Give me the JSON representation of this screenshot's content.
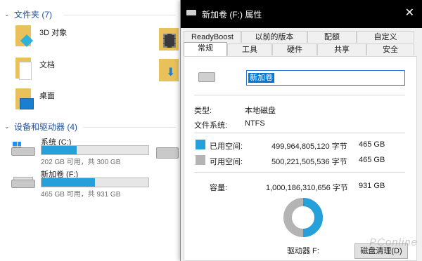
{
  "explorer": {
    "folders_header": "文件夹 (7)",
    "folders": [
      {
        "label": "3D 对象"
      },
      {
        "label": "文档"
      },
      {
        "label": "桌面"
      }
    ],
    "devices_header": "设备和驱动器 (4)",
    "drives": [
      {
        "name": "系统 (C:)",
        "free_text": "202 GB 可用，共 300 GB",
        "used_fraction": 0.33
      },
      {
        "name": "新加卷 (F:)",
        "free_text": "465 GB 可用，共 931 GB",
        "used_fraction": 0.5
      }
    ]
  },
  "dialog": {
    "title": "新加卷 (F:) 属性",
    "tabs_row1": [
      "ReadyBoost",
      "以前的版本",
      "配额",
      "自定义"
    ],
    "tabs_row2": [
      "常规",
      "工具",
      "硬件",
      "共享",
      "安全"
    ],
    "active_tab": "常规",
    "volume_name": "新加卷",
    "type_label": "类型:",
    "type_value": "本地磁盘",
    "fs_label": "文件系统:",
    "fs_value": "NTFS",
    "used_label": "已用空间:",
    "used_bytes": "499,964,805,120 字节",
    "used_gb": "465 GB",
    "free_label": "可用空间:",
    "free_bytes": "500,221,505,536 字节",
    "free_gb": "465 GB",
    "capacity_label": "容量:",
    "capacity_bytes": "1,000,186,310,656 字节",
    "capacity_gb": "931 GB",
    "drive_label": "驱动器 F:",
    "cleanup_button": "磁盘清理(D)",
    "colors": {
      "used": "#26a0da",
      "free": "#b4b4b4"
    },
    "used_fraction": 0.5
  },
  "watermark": "PConline"
}
